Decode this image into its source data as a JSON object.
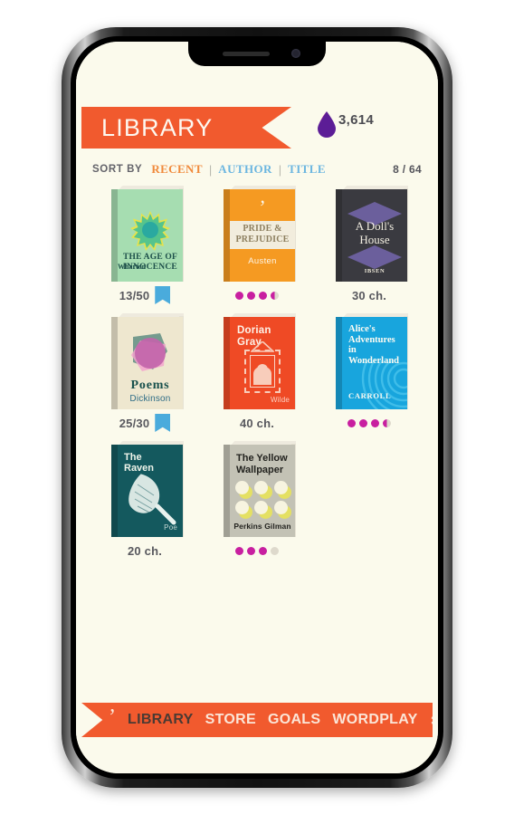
{
  "app": {
    "header": {
      "title": "LIBRARY",
      "ink_icon": "ink-drop-icon",
      "ink_count": "3,614"
    },
    "sort": {
      "label": "SORT BY",
      "options": [
        {
          "label": "RECENT",
          "active": true
        },
        {
          "label": "AUTHOR",
          "active": false
        },
        {
          "label": "TITLE",
          "active": false
        }
      ],
      "separator": "|",
      "count": "8 / 64"
    },
    "books": [
      {
        "title": "THE AGE OF INNOCENCE",
        "title_line1": "THE AGE OF",
        "title_line2": "INNOCENCE",
        "author": "Wharton",
        "cover_color": "#a6ddb1",
        "meta_text": "13/50",
        "bookmark": true,
        "dots": null
      },
      {
        "title": "PRIDE & PREJUDICE",
        "title_line1": "PRIDE &",
        "title_line2": "PREJUDICE",
        "author": "Austen",
        "cover_color": "#f59a22",
        "meta_text": "",
        "bookmark": false,
        "dots": [
          "full",
          "full",
          "full",
          "half"
        ]
      },
      {
        "title": "A Doll's House",
        "title_line1": "A Doll's",
        "title_line2": "House",
        "author": "IBSEN",
        "cover_color": "#3a3a40",
        "meta_text": "30 ch.",
        "bookmark": false,
        "dots": null
      },
      {
        "title": "Poems",
        "title_line1": "Poems",
        "title_line2": "",
        "author": "Dickinson",
        "cover_color": "#eee7cf",
        "meta_text": "25/30",
        "bookmark": true,
        "dots": null
      },
      {
        "title": "Dorian Gray",
        "title_line1": "Dorian",
        "title_line2": "Gray",
        "author": "Wilde",
        "cover_color": "#ef4a25",
        "meta_text": "40 ch.",
        "bookmark": false,
        "dots": null
      },
      {
        "title": "Alice's Adventures in Wonderland",
        "title_line1": "Alice's",
        "title_line2": "Adventures",
        "title_line3": "in",
        "title_line4": "Wonderland",
        "author": "CARROLL",
        "cover_color": "#18a5dd",
        "meta_text": "",
        "bookmark": false,
        "dots": [
          "full",
          "full",
          "full",
          "half"
        ]
      },
      {
        "title": "The Raven",
        "title_line1": "The",
        "title_line2": "Raven",
        "author": "Poe",
        "cover_color": "#14595e",
        "meta_text": "20 ch.",
        "bookmark": false,
        "dots": null
      },
      {
        "title": "The Yellow Wallpaper",
        "title_line1": "The Yellow",
        "title_line2": "Wallpaper",
        "author": "Perkins Gilman",
        "cover_color": "#c3c2b5",
        "meta_text": "",
        "bookmark": false,
        "dots": [
          "full",
          "full",
          "full",
          "empty"
        ]
      }
    ],
    "bottom_nav": {
      "logo": "comma-logo-icon",
      "items": [
        {
          "label": "LIBRARY",
          "active": true
        },
        {
          "label": "STORE",
          "active": false
        },
        {
          "label": "GOALS",
          "active": false
        },
        {
          "label": "WORDPLAY",
          "active": false
        }
      ],
      "settings_icon": "gear-icon"
    }
  },
  "colors": {
    "accent_orange": "#f15a2e",
    "screen_bg": "#fbfaec",
    "bookmark_blue": "#4aabdc",
    "dot_magenta": "#c81fa0",
    "ink_purple": "#5c1d96",
    "sort_active": "#f08a3c",
    "sort_inactive": "#6cb6e0"
  }
}
